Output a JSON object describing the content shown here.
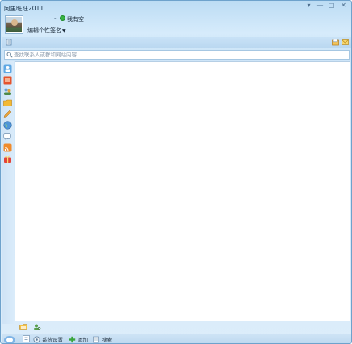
{
  "window": {
    "title": "阿里旺旺2011",
    "buttons": {
      "menu": "▾",
      "minimize": "—",
      "maximize": "□",
      "close": "✕"
    }
  },
  "profile": {
    "status_text": "我有空",
    "signature": "编辑个性签名"
  },
  "search": {
    "placeholder": "查找联系人或群和网站内容"
  },
  "rail_icons": [
    "contacts-icon",
    "shop-icon",
    "group-icon",
    "folder-icon",
    "pencil-icon",
    "globe-icon",
    "chat-icon",
    "feed-icon",
    "gift-icon"
  ],
  "statusbar": {
    "settings_label": "系统设置",
    "add_label": "添加",
    "find_label": "搜索"
  },
  "colors": {
    "accent": "#6ea2cc",
    "online": "#37b443",
    "panel": "#ffffff"
  }
}
